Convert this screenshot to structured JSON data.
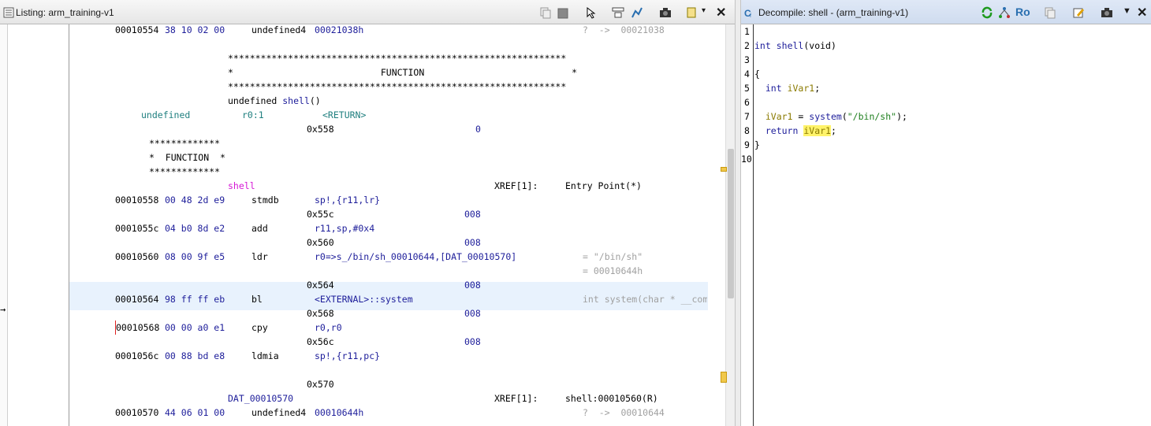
{
  "listing": {
    "title": "Listing:  arm_training-v1",
    "lines": {
      "l1_addr": "00010554",
      "l1_bytes": "38 10 02 00",
      "l1_mn": "undefined4",
      "l1_op": "00021038h",
      "l1_cmt": "?  ->  00021038",
      "stars_long": "**************************************************************",
      "func_banner": "*                           FUNCTION                           *",
      "sig_pre": "undefined ",
      "sig_name": "shell",
      "sig_post": "()",
      "ret_type": "undefined",
      "ret_reg": "r0:1",
      "ret_label": "<RETURN>",
      "off_558": "0x558",
      "val_558": "0",
      "stars_short": "*************",
      "func_short": "*  FUNCTION  *",
      "label_shell": "shell",
      "xref1": "XREF[1]:",
      "xref1_target": "Entry Point(*)",
      "a558": "00010558",
      "b558": "00 48 2d e9",
      "m558": "stmdb",
      "o558": "sp!,{r11,lr}",
      "off_55c": "0x55c",
      "v_55c": "008",
      "a55c": "0001055c",
      "b55c": "04 b0 8d e2",
      "m55c": "add",
      "o55c": "r11,sp,#0x4",
      "off_560": "0x560",
      "v_560": "008",
      "a560": "00010560",
      "b560": "08 00 9f e5",
      "m560": "ldr",
      "o560": "r0=>s_/bin/sh_00010644,[DAT_00010570]",
      "c560a": "= \"/bin/sh\"",
      "c560b": "= 00010644h",
      "off_564": "0x564",
      "v_564": "008",
      "a564": "00010564",
      "b564": "98 ff ff eb",
      "m564": "bl",
      "o564": "<EXTERNAL>::system",
      "c564": "int system(char * __com",
      "off_568": "0x568",
      "v_568": "008",
      "a568": "00010568",
      "b568": "00 00 a0 e1",
      "m568": "cpy",
      "o568": "r0,r0",
      "off_56c": "0x56c",
      "v_56c": "008",
      "a56c": "0001056c",
      "b56c": "00 88 bd e8",
      "m56c": "ldmia",
      "o56c": "sp!,{r11,pc}",
      "off_570": "0x570",
      "dat_label": "DAT_00010570",
      "xref2": "XREF[1]:",
      "xref2_target": "shell:00010560(R)",
      "a570": "00010570",
      "b570": "44 06 01 00",
      "m570": "undefined4",
      "o570": "00010644h",
      "c570": "?  ->  00010644"
    }
  },
  "decompile": {
    "title": "Decompile: shell -  (arm_training-v1)",
    "ro_label": "Ro",
    "line_numbers": [
      "1",
      "2",
      "3",
      "4",
      "5",
      "6",
      "7",
      "8",
      "9",
      "10"
    ],
    "code": {
      "l2_type": "int",
      "l2_name": "shell",
      "l2_args": "(void)",
      "l4": "{",
      "l5_type": "int",
      "l5_var": "iVar1",
      "l5_end": ";",
      "l7_var": "iVar1",
      "l7_eq": " = ",
      "l7_fn": "system",
      "l7_open": "(",
      "l7_str": "\"/bin/sh\"",
      "l7_close": ");",
      "l8_kw": "return",
      "l8_var": "iVar1",
      "l8_end": ";",
      "l9": "}"
    }
  },
  "colors": {
    "accent": "#1d1d9a",
    "highlight": "#fff36a",
    "selection_row": "#e8f2fd"
  }
}
